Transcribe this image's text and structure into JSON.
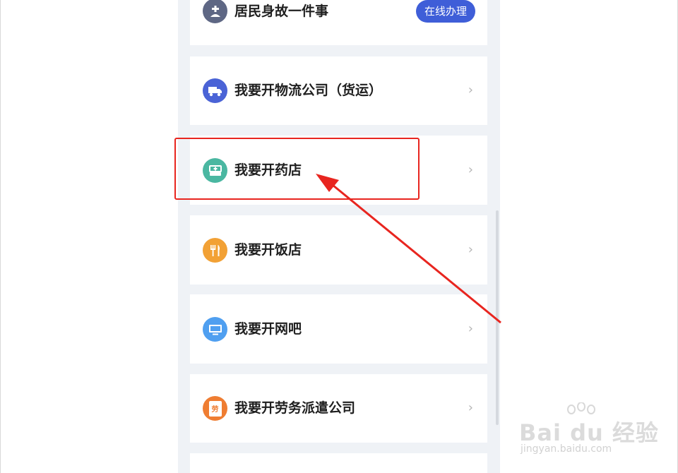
{
  "services": [
    {
      "label": "居民身故一件事",
      "icon": "person-with-cross-icon",
      "color": "#5e6784",
      "action": "在线办理"
    },
    {
      "label": "我要开物流公司（货运）",
      "icon": "truck-icon",
      "color": "#4a63d6",
      "action": "chevron"
    },
    {
      "label": "我要开药店",
      "icon": "medicine-box-icon",
      "color": "#4ab7a1",
      "action": "chevron"
    },
    {
      "label": "我要开饭店",
      "icon": "fork-knife-icon",
      "color": "#f2a135",
      "action": "chevron"
    },
    {
      "label": "我要开网吧",
      "icon": "monitor-icon",
      "color": "#4f9ff0",
      "action": "chevron"
    },
    {
      "label": "我要开劳务派遣公司",
      "icon": "document-labor-icon",
      "color": "#ef7d32",
      "action": "chevron",
      "icon_text": "劳"
    }
  ],
  "chevron_glyph": "›",
  "annotation": {
    "box_color": "#e8251f"
  },
  "watermark": {
    "brand": "Bai du 经验",
    "url": "jingyan.baidu.com"
  }
}
